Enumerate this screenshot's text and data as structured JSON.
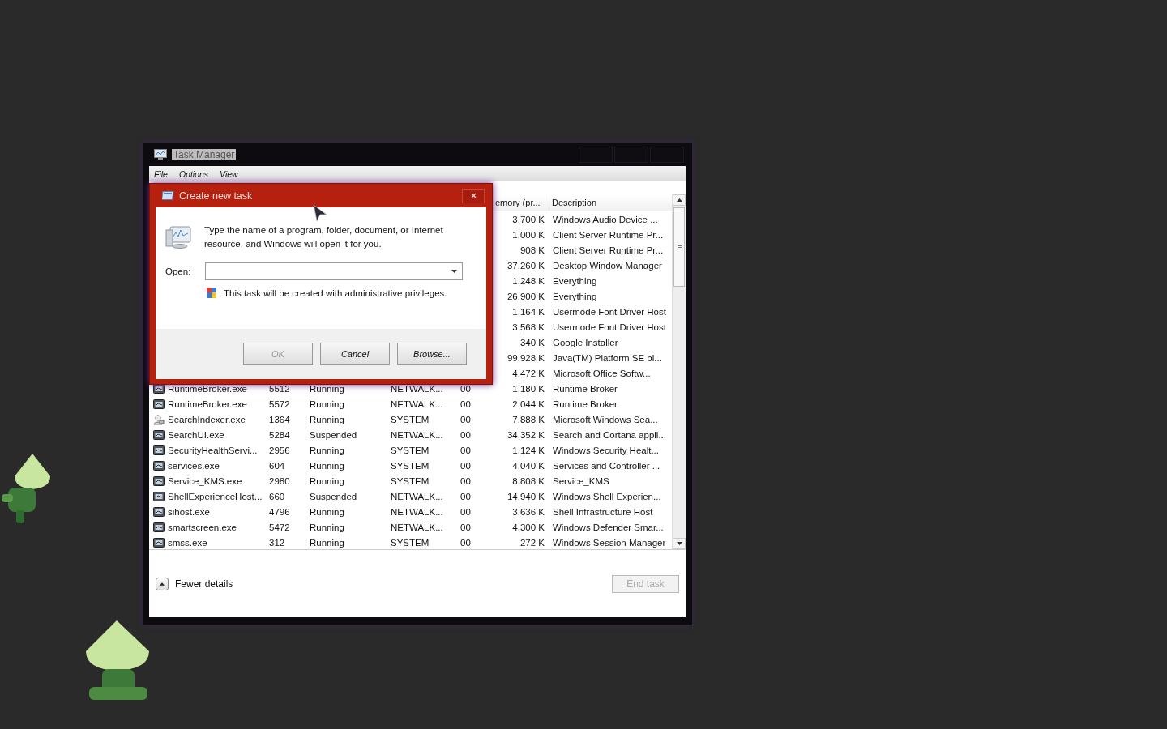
{
  "window": {
    "title": "Task Manager"
  },
  "menu": [
    "File",
    "Options",
    "View"
  ],
  "header": {
    "memory": "emory (pr...",
    "description": "Description"
  },
  "rows": [
    {
      "memory": "3,700 K",
      "description": "Windows Audio Device ..."
    },
    {
      "memory": "1,000 K",
      "description": "Client Server Runtime Pr..."
    },
    {
      "memory": "908 K",
      "description": "Client Server Runtime Pr..."
    },
    {
      "memory": "37,260 K",
      "description": "Desktop Window Manager"
    },
    {
      "memory": "1,248 K",
      "description": "Everything"
    },
    {
      "memory": "26,900 K",
      "description": "Everything"
    },
    {
      "memory": "1,164 K",
      "description": "Usermode Font Driver Host"
    },
    {
      "memory": "3,568 K",
      "description": "Usermode Font Driver Host"
    },
    {
      "memory": "340 K",
      "description": "Google Installer"
    },
    {
      "memory": "99,928 K",
      "description": "Java(TM) Platform SE bi..."
    },
    {
      "memory": "4,472 K",
      "description": "Microsoft Office Softw..."
    },
    {
      "kind": "app",
      "name": "RuntimeBroker.exe",
      "pid": "5512",
      "status": "Running",
      "user": "NETWALK...",
      "cpu": "00",
      "memory": "1,180 K",
      "description": "Runtime Broker"
    },
    {
      "kind": "app",
      "name": "RuntimeBroker.exe",
      "pid": "5572",
      "status": "Running",
      "user": "NETWALK...",
      "cpu": "00",
      "memory": "2,044 K",
      "description": "Runtime Broker"
    },
    {
      "kind": "user",
      "name": "SearchIndexer.exe",
      "pid": "1364",
      "status": "Running",
      "user": "SYSTEM",
      "cpu": "00",
      "memory": "7,888 K",
      "description": "Microsoft Windows Sea..."
    },
    {
      "kind": "app",
      "name": "SearchUI.exe",
      "pid": "5284",
      "status": "Suspended",
      "user": "NETWALK...",
      "cpu": "00",
      "memory": "34,352 K",
      "description": "Search and Cortana appli..."
    },
    {
      "kind": "app",
      "name": "SecurityHealthServi...",
      "pid": "2956",
      "status": "Running",
      "user": "SYSTEM",
      "cpu": "00",
      "memory": "1,124 K",
      "description": "Windows Security Healt..."
    },
    {
      "kind": "app",
      "name": "services.exe",
      "pid": "604",
      "status": "Running",
      "user": "SYSTEM",
      "cpu": "00",
      "memory": "4,040 K",
      "description": "Services and Controller ..."
    },
    {
      "kind": "app",
      "name": "Service_KMS.exe",
      "pid": "2980",
      "status": "Running",
      "user": "SYSTEM",
      "cpu": "00",
      "memory": "8,808 K",
      "description": "Service_KMS"
    },
    {
      "kind": "app",
      "name": "ShellExperienceHost...",
      "pid": "660",
      "status": "Suspended",
      "user": "NETWALK...",
      "cpu": "00",
      "memory": "14,940 K",
      "description": "Windows Shell Experien..."
    },
    {
      "kind": "app",
      "name": "sihost.exe",
      "pid": "4796",
      "status": "Running",
      "user": "NETWALK...",
      "cpu": "00",
      "memory": "3,636 K",
      "description": "Shell Infrastructure Host"
    },
    {
      "kind": "app",
      "name": "smartscreen.exe",
      "pid": "5472",
      "status": "Running",
      "user": "NETWALK...",
      "cpu": "00",
      "memory": "4,300 K",
      "description": "Windows Defender Smar..."
    },
    {
      "kind": "app",
      "name": "smss.exe",
      "pid": "312",
      "status": "Running",
      "user": "SYSTEM",
      "cpu": "00",
      "memory": "272 K",
      "description": "Windows Session Manager"
    }
  ],
  "footer": {
    "fewer_details": "Fewer details",
    "end_task": {
      "label": "End task",
      "disabled": true
    }
  },
  "dialog": {
    "title": "Create new task",
    "message": "Type the name of a program, folder, document, or Internet resource, and Windows will open it for you.",
    "open_label": "Open:",
    "note": "This task will be created with administrative privileges.",
    "buttons": [
      {
        "label": "OK",
        "disabled": true
      },
      {
        "label": "Cancel",
        "disabled": false
      },
      {
        "label": "Browse...",
        "disabled": false
      }
    ]
  }
}
